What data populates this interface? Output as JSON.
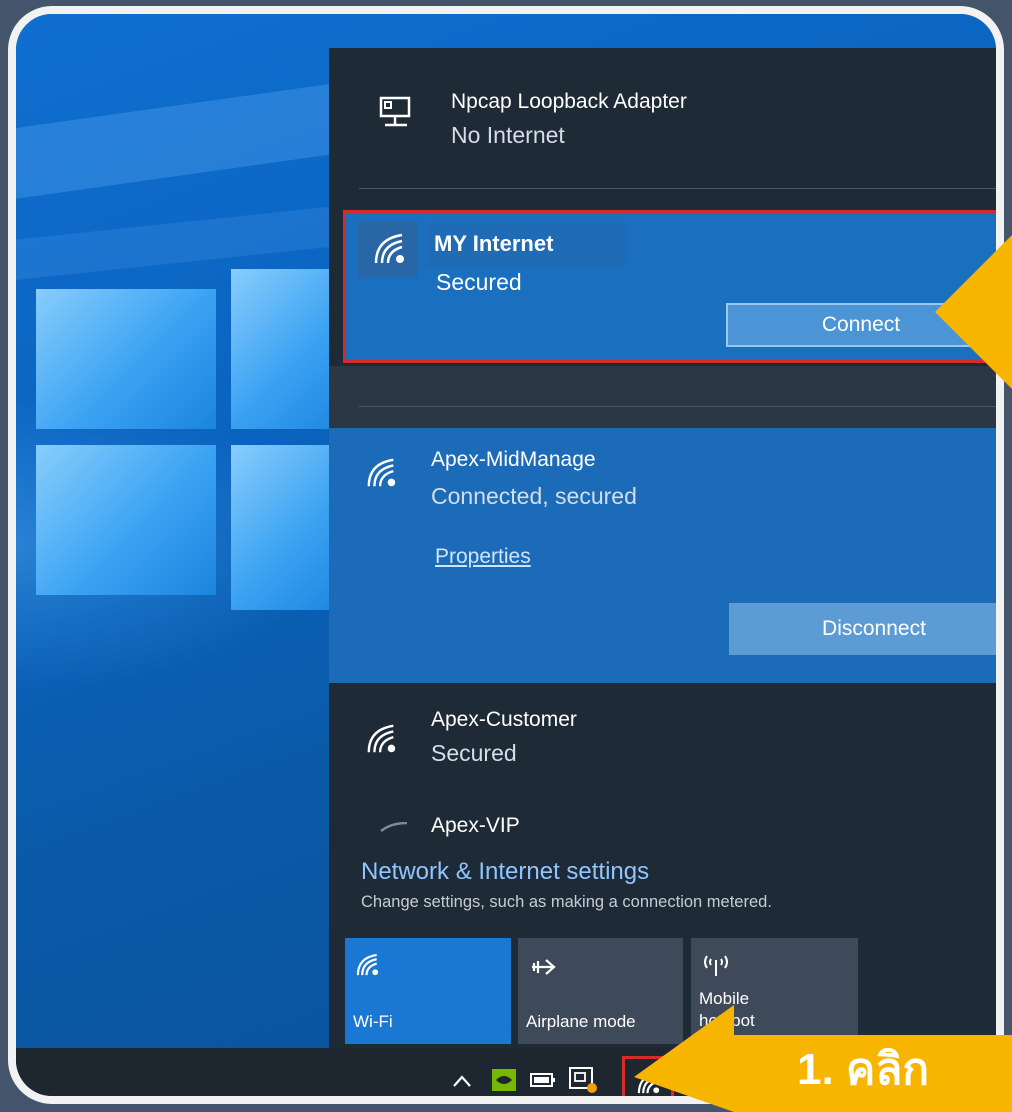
{
  "networks": {
    "npcap": {
      "name": "Npcap Loopback Adapter",
      "status": "No Internet"
    },
    "selected": {
      "name": "MY Internet",
      "status": "Secured",
      "connect_label": "Connect"
    },
    "connected": {
      "name": "Apex-MidManage",
      "status": "Connected, secured",
      "properties_label": "Properties",
      "disconnect_label": "Disconnect"
    },
    "customer": {
      "name": "Apex-Customer",
      "status": "Secured"
    },
    "vip": {
      "name": "Apex-VIP"
    }
  },
  "settings": {
    "title": "Network & Internet settings",
    "subtitle": "Change settings, such as making a connection metered."
  },
  "quick_actions": [
    {
      "label": "Wi-Fi",
      "icon": "wifi-icon",
      "active": true
    },
    {
      "label": "Airplane mode",
      "icon": "airplane-icon",
      "active": false
    },
    {
      "label": "Mobile\nhotspot",
      "icon": "hotspot-icon",
      "active": false
    }
  ],
  "tray_icons": [
    "chevron-up-icon",
    "nvidia-icon",
    "battery-icon",
    "display-icon",
    "wifi-icon"
  ],
  "callout": {
    "step_label": "1. คลิก"
  },
  "colors": {
    "accent": "#1a6fbf",
    "highlight_border": "#d62b2b",
    "callout": "#f7b500",
    "flyout_bg": "#1f2a37"
  }
}
